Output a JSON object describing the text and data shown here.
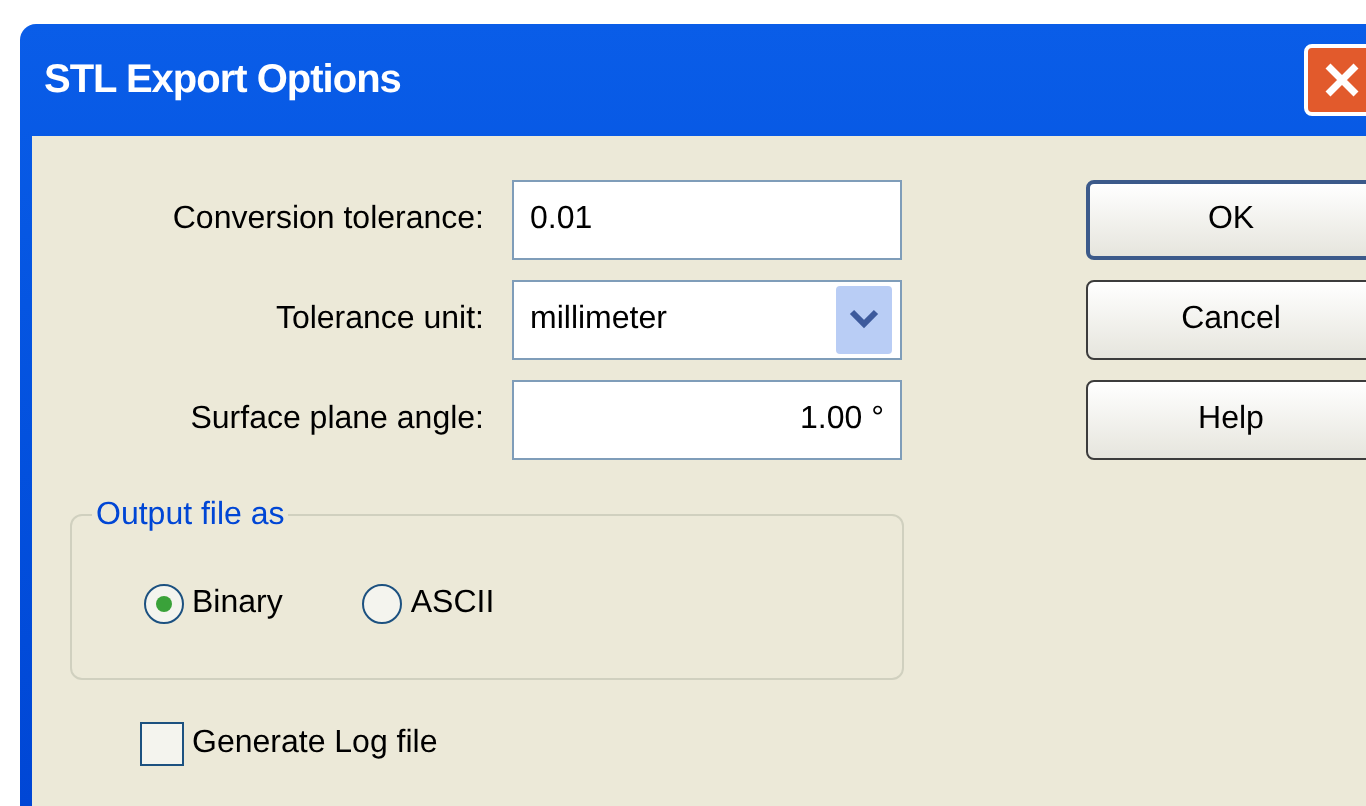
{
  "window": {
    "title": "STL Export Options"
  },
  "fields": [
    {
      "kind": "text",
      "label": "Conversion tolerance:",
      "value": "0.01"
    },
    {
      "kind": "dropdown",
      "label": "Tolerance unit:",
      "value": "millimeter"
    },
    {
      "kind": "number",
      "label": "Surface plane angle:",
      "value": "1.00 °"
    }
  ],
  "buttons": [
    "OK",
    "Cancel",
    "Help"
  ],
  "output_group": {
    "title": "Output file as",
    "options": [
      {
        "label": "Binary",
        "selected": true
      },
      {
        "label": "ASCII",
        "selected": false
      }
    ]
  },
  "log_checkbox": {
    "label": "Generate Log file",
    "checked": false
  }
}
